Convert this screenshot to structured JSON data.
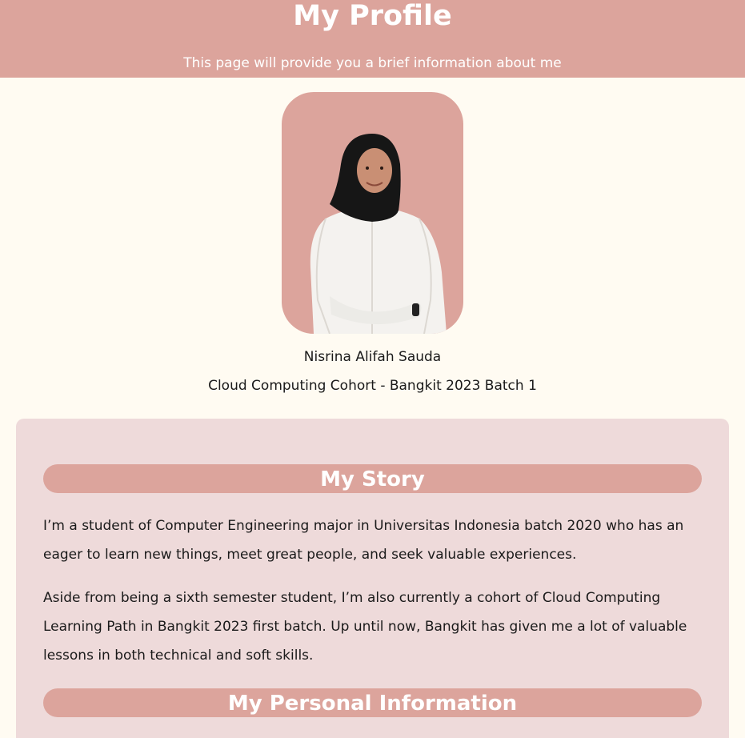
{
  "header": {
    "title": "My Profile",
    "subtitle": "This page will provide you a brief information about me"
  },
  "profile": {
    "name": "Nisrina Alifah Sauda",
    "cohort": "Cloud Computing Cohort - Bangkit 2023 Batch 1"
  },
  "story": {
    "heading": "My Story",
    "paragraphs": [
      "I’m a student of Computer Engineering major in Universitas Indonesia batch 2020 who has an eager to learn new things, meet great people, and seek valuable experiences.",
      "Aside from being a sixth semester student, I’m also currently a cohort of Cloud Computing Learning Path in Bangkit 2023 first batch. Up until now, Bangkit has given me a lot of valuable lessons in both technical and soft skills."
    ]
  },
  "personal": {
    "heading": "My Personal Information"
  },
  "colors": {
    "accent": "#dca49c",
    "page_background": "#fffbf2",
    "card_background": "#eedada"
  }
}
